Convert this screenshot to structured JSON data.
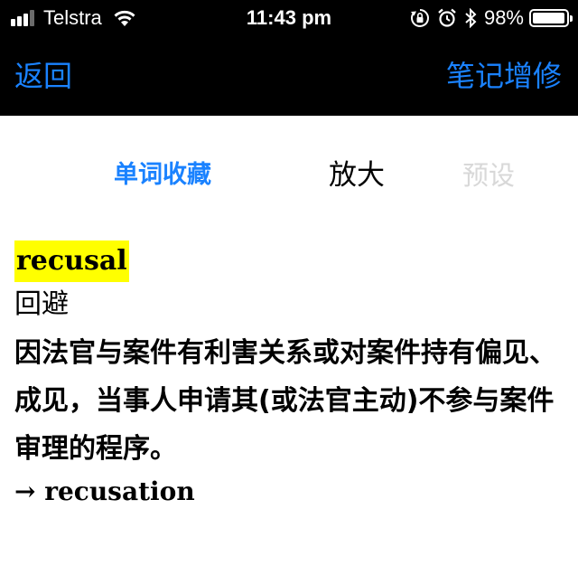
{
  "status_bar": {
    "carrier": "Telstra",
    "time": "11:43 pm",
    "battery_percent": "98%",
    "battery_level": 0.98,
    "signal_bars_active": 3,
    "signal_bars_total": 4,
    "icons": [
      "signal-icon",
      "wifi-icon",
      "orientation-lock-icon",
      "alarm-icon",
      "bluetooth-icon",
      "battery-icon"
    ]
  },
  "nav": {
    "back_label": "返回",
    "notes_label": "笔记增修"
  },
  "tabs": {
    "favorites": "单词收藏",
    "zoom": "放大",
    "preset": "预设"
  },
  "entry": {
    "headword": "recusal",
    "translation": "回避",
    "definition": "因法官与案件有利害关系或对案件持有偏见、成见，当事人申请其(或法官主动)不参与案件审理的程序。",
    "cross_reference": "→ recusation"
  },
  "colors": {
    "accent": "#1a82ff",
    "highlight": "#ffff00",
    "bar_background": "#000000",
    "disabled_text": "#d8d8d8"
  }
}
